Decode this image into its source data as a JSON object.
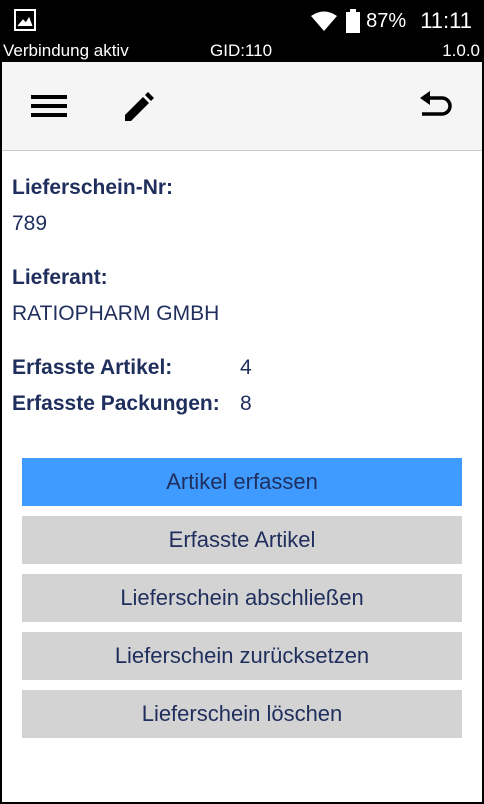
{
  "statusbar": {
    "battery_percent": "87%",
    "time": "11:11",
    "icons": [
      "image-icon",
      "wifi-icon",
      "battery-icon"
    ]
  },
  "infobar": {
    "connection": "Verbindung aktiv",
    "gid": "GID:110",
    "version": "1.0.0"
  },
  "toolbar": {
    "icons": [
      "menu-icon",
      "edit-icon",
      "undo-icon"
    ]
  },
  "delivery": {
    "number_label": "Lieferschein-Nr:",
    "number_value": "789",
    "supplier_label": "Lieferant:",
    "supplier_value": "RATIOPHARM GMBH",
    "articles_label": "Erfasste Artikel:",
    "articles_value": "4",
    "packages_label": "Erfasste Packungen:",
    "packages_value": "8"
  },
  "actions": {
    "capture_articles": "Artikel erfassen",
    "captured_articles": "Erfasste Artikel",
    "close_delivery": "Lieferschein abschließen",
    "reset_delivery": "Lieferschein zurücksetzen",
    "delete_delivery": "Lieferschein löschen"
  },
  "colors": {
    "primary_button": "#3f9bff",
    "secondary_button": "#d3d3d3",
    "text": "#1f2e5c"
  }
}
